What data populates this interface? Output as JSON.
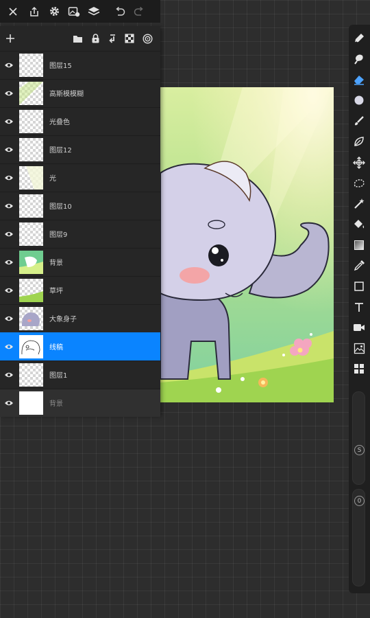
{
  "colors": {
    "accent": "#0a84ff",
    "active_tool": "#4da3ff",
    "panel": "#262626"
  },
  "top_toolbar": {
    "icons": [
      "close-icon",
      "share-icon",
      "settings-icon",
      "gallery-icon",
      "layers-icon",
      "undo-icon",
      "redo-icon"
    ]
  },
  "layers": {
    "header_icons": [
      "add-icon",
      "folder-icon",
      "lock-icon",
      "merge-down-icon",
      "alpha-lock-icon",
      "mask-icon"
    ],
    "items": [
      {
        "name": "图层15",
        "selected": false
      },
      {
        "name": "高斯模模糊",
        "selected": false
      },
      {
        "name": "光叠色",
        "selected": false
      },
      {
        "name": "图层12",
        "selected": false
      },
      {
        "name": "光",
        "selected": false
      },
      {
        "name": "图层10",
        "selected": false
      },
      {
        "name": "图层9",
        "selected": false
      },
      {
        "name": "背景",
        "selected": false
      },
      {
        "name": "草坪",
        "selected": false
      },
      {
        "name": "大象身子",
        "selected": false
      },
      {
        "name": "线稿",
        "selected": true
      },
      {
        "name": "图层1",
        "selected": false
      },
      {
        "name": "背景",
        "selected": false
      }
    ]
  },
  "tools": {
    "items": [
      "pen-icon",
      "smudge-icon",
      "eraser-icon",
      "color-icon",
      "brush-icon",
      "leaf-icon",
      "move-icon",
      "lasso-icon",
      "magic-wand-icon",
      "fill-icon",
      "gradient-icon",
      "eyedropper-icon",
      "rectangle-icon",
      "text-icon",
      "video-icon",
      "image-icon",
      "grid-icon"
    ],
    "active": "eraser-icon",
    "size_slider_label": "S",
    "opacity_slider_label": "0"
  }
}
